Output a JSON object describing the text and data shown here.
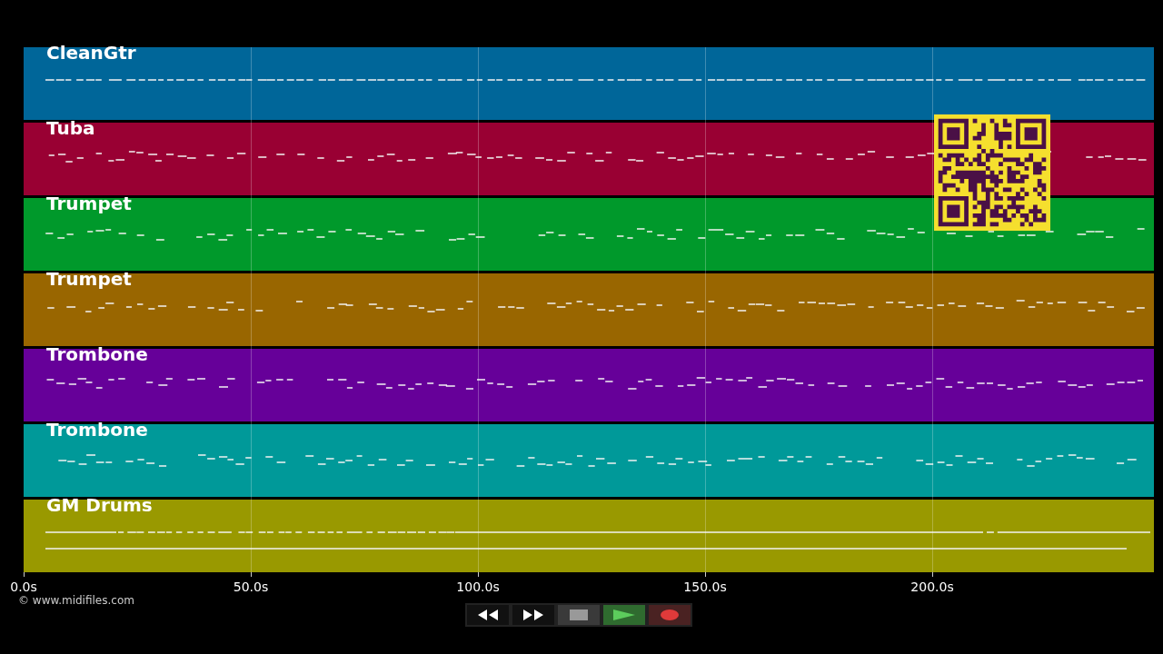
{
  "tracks": [
    {
      "name": "CleanGtr",
      "color": "#006699"
    },
    {
      "name": "Tuba",
      "color": "#990033"
    },
    {
      "name": "Trumpet",
      "color": "#00992b"
    },
    {
      "name": "Trumpet",
      "color": "#996600"
    },
    {
      "name": "Trombone",
      "color": "#660099"
    },
    {
      "name": "Trombone",
      "color": "#009999"
    },
    {
      "name": "GM Drums",
      "color": "#999900"
    }
  ],
  "time_axis": [
    "0.0s",
    "50.0s",
    "100.0s",
    "150.0s",
    "200.0s"
  ],
  "credit": "© www.midifiles.com",
  "controls": [
    {
      "kind": "rewind"
    },
    {
      "kind": "forward"
    },
    {
      "kind": "stop"
    },
    {
      "kind": "play"
    },
    {
      "kind": "record"
    }
  ]
}
